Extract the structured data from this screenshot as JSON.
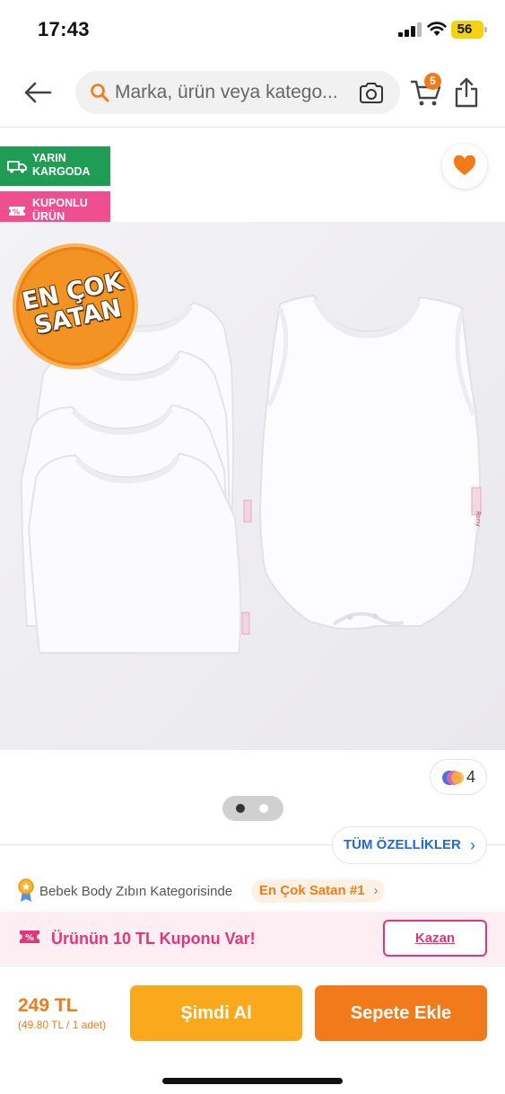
{
  "status_bar": {
    "time": "17:43",
    "battery": "56"
  },
  "nav": {
    "search_placeholder": "Marka, ürün veya katego...",
    "cart_count": "5"
  },
  "badges": {
    "cargo_label": "YARIN KARGODA",
    "coupon_label": "KUPONLU ÜRÜN"
  },
  "product": {
    "ribbon_text": "EN ÇOK SATAN",
    "garment_tag": "Rony",
    "color_count": "4",
    "image_count": 2,
    "active_image_index": 0
  },
  "features": {
    "all_features_label": "TÜM ÖZELLİKLER"
  },
  "category": {
    "text": "Bebek Body Zıbın Kategorisinde",
    "rank_label": "En Çok Satan #1"
  },
  "coupon": {
    "text": "Ürünün 10 TL Kuponu Var!",
    "button_label": "Kazan"
  },
  "purchase": {
    "price": "249 TL",
    "unit_price": "(49.80 TL / 1 adet)",
    "buy_now_label": "Şimdi Al",
    "add_to_cart_label": "Sepete Ekle"
  },
  "colors": {
    "accent": "#f27a1a",
    "cargo_green": "#1f9d55",
    "coupon_pink": "#e4357b",
    "buy_now_yellow": "#f9a91b",
    "link_blue": "#1f6ad6"
  }
}
